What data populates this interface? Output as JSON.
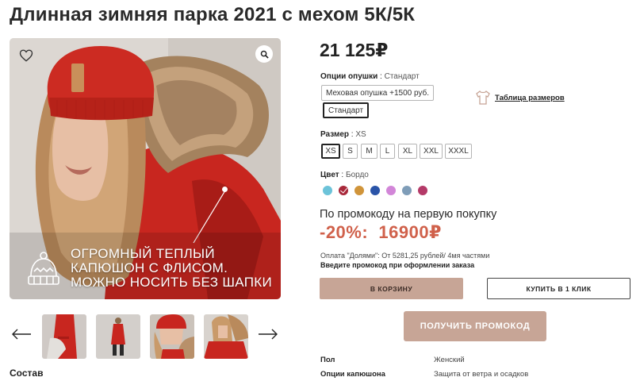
{
  "product": {
    "title": "Длинная зимняя парка 2021 с мехом 5К/5К",
    "price": "21 125₽"
  },
  "hero": {
    "caption_lines": [
      "ОГРОМНЫЙ ТЕПЛЫЙ",
      "КАПЮШОН С ФЛИСОМ.",
      "МОЖНО НОСИТЬ БЕЗ ШАПКИ"
    ],
    "slides_count": 5
  },
  "trim_option": {
    "label": "Опции опушки",
    "selected": "Стандарт",
    "options": [
      "Меховая опушка +1500 руб.",
      "Стандарт"
    ]
  },
  "size_table_link": "Таблица размеров",
  "size": {
    "label": "Размер",
    "selected": "XS",
    "options": [
      "XS",
      "S",
      "M",
      "L",
      "XL",
      "XXL",
      "XXXL"
    ]
  },
  "color": {
    "label": "Цвет",
    "selected": "Бордо",
    "swatches": [
      "#6cc3d9",
      "#a8283a",
      "#d0943a",
      "#2a54a8",
      "#d286d8",
      "#7f9db8",
      "#b43a68"
    ]
  },
  "promo": {
    "heading": "По промокоду на первую покупку",
    "discount": "-20%:",
    "price": "16900₽",
    "dolyami": "Оплата \"Долями\": От 5281,25 рублей/ 4мя частями",
    "note": "Введите промокод при оформлении заказа"
  },
  "buttons": {
    "cart": "В КОРЗИНУ",
    "one_click": "КУПИТЬ В 1 КЛИК",
    "get_promo": "ПОЛУЧИТЬ ПРОМОКОД"
  },
  "specs": [
    {
      "key": "Пол",
      "value": "Женский"
    },
    {
      "key": "Опции капюшона",
      "value": "Защита от ветра и осадков"
    }
  ],
  "composition_heading": "Состав",
  "colors": {
    "accent": "#c7a596",
    "promo": "#d0614b",
    "jacket": "#c8261f"
  }
}
